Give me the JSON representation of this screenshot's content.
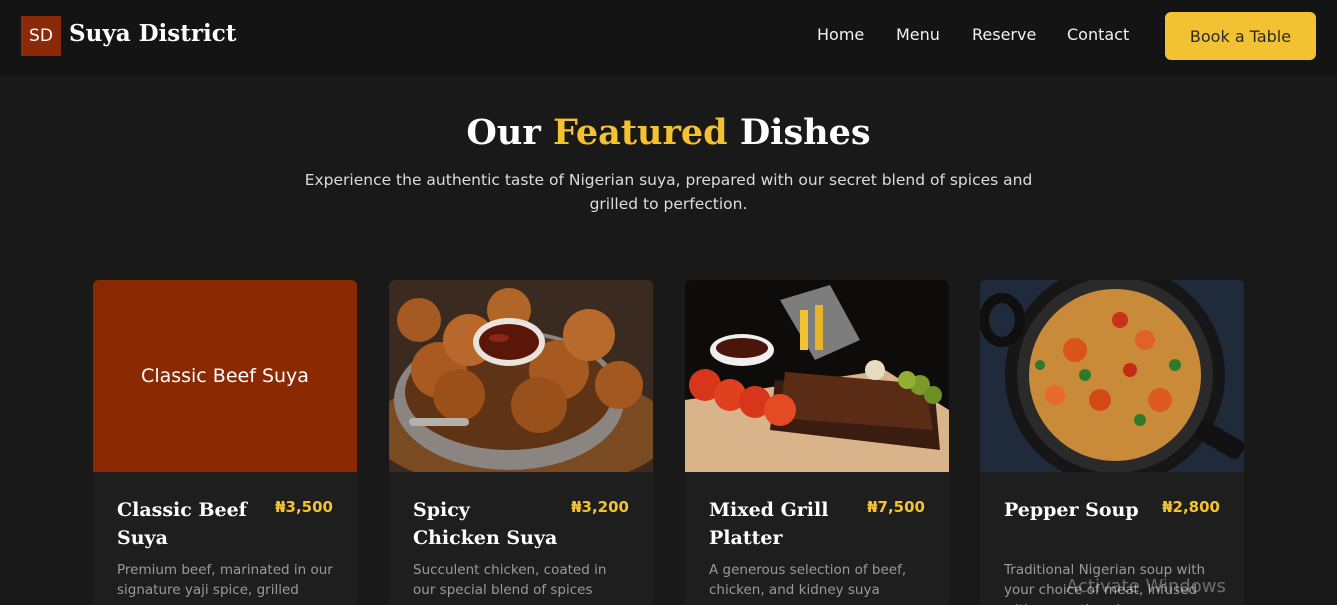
{
  "header": {
    "logo_text": "SD",
    "brand": "Suya District",
    "nav": [
      "Home",
      "Menu",
      "Reserve",
      "Contact"
    ],
    "cta": "Book a Table"
  },
  "section": {
    "title_part1": "Our ",
    "title_highlight": "Featured",
    "title_part2": " Dishes",
    "subtitle": "Experience the authentic taste of Nigerian suya, prepared with our secret blend of spices and grilled to perfection."
  },
  "cards": [
    {
      "image_label": "Classic Beef Suya",
      "name": "Classic Beef Suya",
      "price": "₦3,500",
      "desc": "Premium beef, marinated in our signature yaji spice, grilled"
    },
    {
      "name": "Spicy Chicken Suya",
      "price": "₦3,200",
      "desc": "Succulent chicken, coated in our special blend of spices"
    },
    {
      "name": "Mixed Grill Platter",
      "price": "₦7,500",
      "desc": "A generous selection of beef, chicken, and kidney suya"
    },
    {
      "name": "Pepper Soup",
      "price": "₦2,800",
      "desc": "Traditional Nigerian soup with your choice of meat, infused with aromatic spices"
    }
  ],
  "overlay": {
    "activate_windows": "Activate Windows"
  },
  "colors": {
    "accent": "#f2c233",
    "brand_red": "#8b2a02",
    "background": "#191919"
  }
}
